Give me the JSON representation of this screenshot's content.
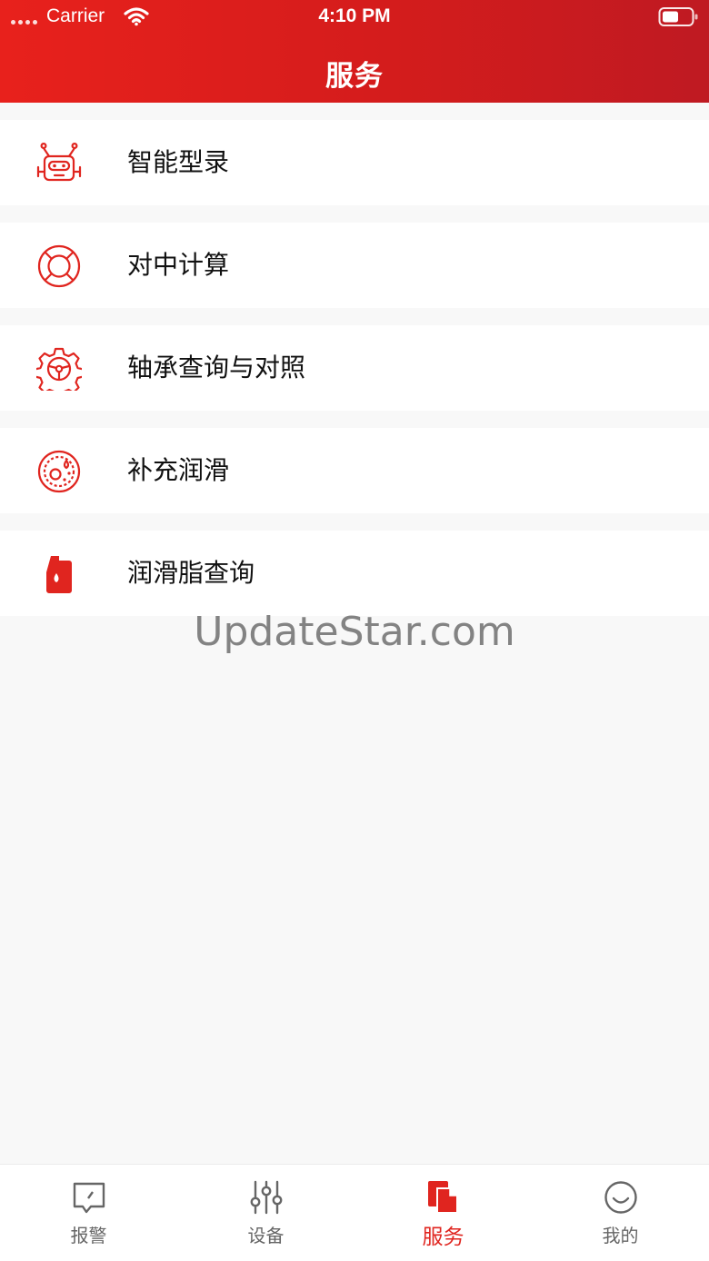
{
  "status_bar": {
    "carrier": "Carrier",
    "time": "4:10 PM"
  },
  "header": {
    "title": "服务"
  },
  "colors": {
    "brand_red": "#e0251f",
    "background": "#f8f8f8",
    "inactive_tab": "#666666"
  },
  "menu": {
    "items": [
      {
        "label": "智能型录",
        "icon": "robot-icon"
      },
      {
        "label": "对中计算",
        "icon": "lifebuoy-icon"
      },
      {
        "label": "轴承查询与对照",
        "icon": "gear-steering-icon"
      },
      {
        "label": "补充润滑",
        "icon": "lubrication-disc-icon"
      },
      {
        "label": "润滑脂查询",
        "icon": "grease-can-icon"
      }
    ]
  },
  "watermark": "UpdateStar.com",
  "tabbar": {
    "active_index": 2,
    "tabs": [
      {
        "label": "报警",
        "icon": "alarm-edit-icon"
      },
      {
        "label": "设备",
        "icon": "sliders-icon"
      },
      {
        "label": "服务",
        "icon": "service-doc-icon"
      },
      {
        "label": "我的",
        "icon": "smile-icon"
      }
    ]
  }
}
